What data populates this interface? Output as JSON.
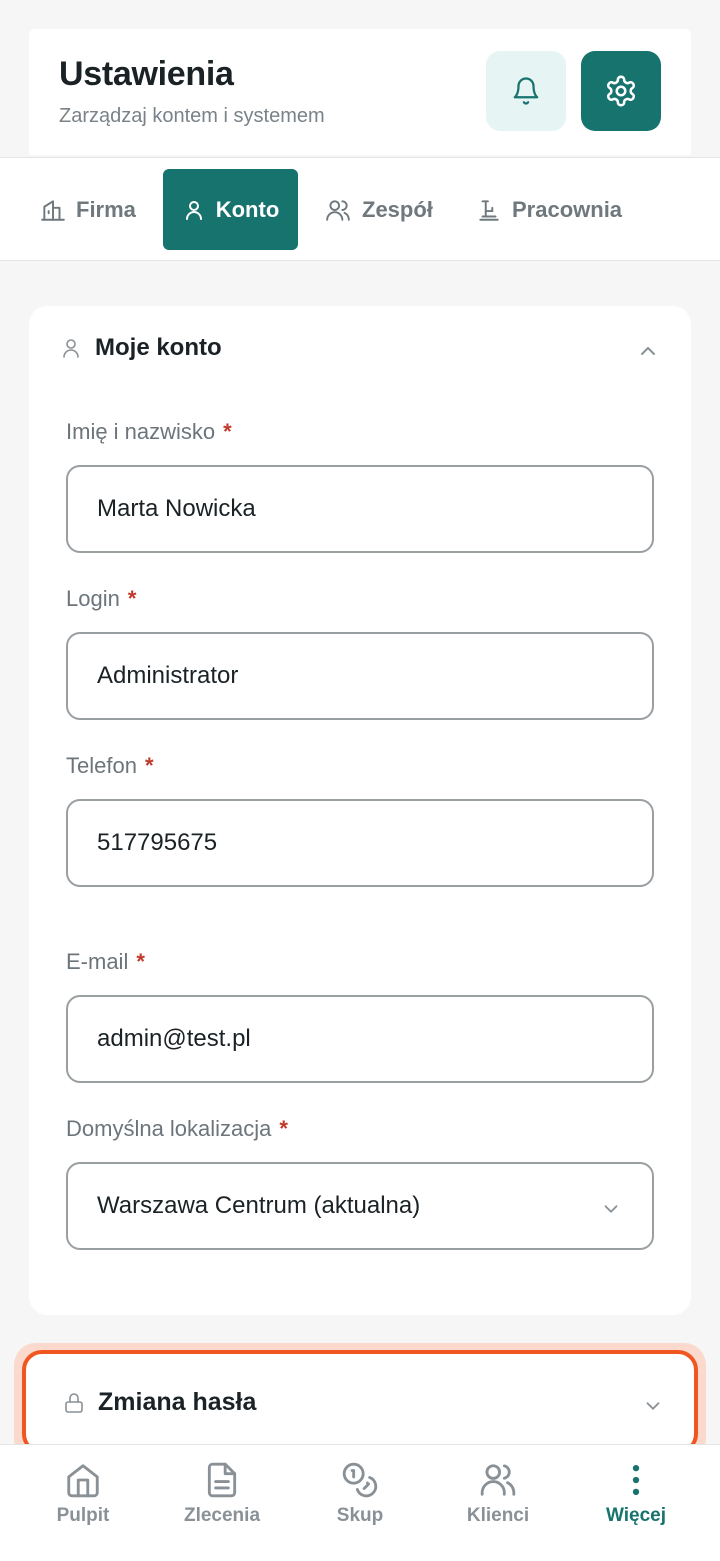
{
  "header": {
    "title": "Ustawienia",
    "subtitle": "Zarządzaj kontem i systemem",
    "bell_icon": "bell-icon",
    "settings_icon": "gear-icon"
  },
  "tabs": [
    {
      "label": "Firma",
      "icon": "building-icon",
      "active": false
    },
    {
      "label": "Konto",
      "icon": "user-icon",
      "active": true
    },
    {
      "label": "Zespół",
      "icon": "users-icon",
      "active": false
    },
    {
      "label": "Pracownia",
      "icon": "workbench-icon",
      "active": false
    }
  ],
  "account": {
    "title": "Moje konto",
    "fields": {
      "name": {
        "label": "Imię i nazwisko",
        "required": "*",
        "value": "Marta Nowicka"
      },
      "login": {
        "label": "Login",
        "required": "*",
        "value": "Administrator"
      },
      "phone": {
        "label": "Telefon",
        "required": "*",
        "value": "517795675"
      },
      "email": {
        "label": "E-mail",
        "required": "*",
        "value": "admin@test.pl"
      },
      "location": {
        "label": "Domyślna lokalizacja",
        "required": "*",
        "value": "Warszawa Centrum (aktualna)"
      }
    }
  },
  "password": {
    "title": "Zmiana hasła"
  },
  "bottom_nav": [
    {
      "label": "Pulpit",
      "icon": "home-icon",
      "active": false
    },
    {
      "label": "Zlecenia",
      "icon": "document-icon",
      "active": false
    },
    {
      "label": "Skup",
      "icon": "coins-icon",
      "active": false
    },
    {
      "label": "Klienci",
      "icon": "users-icon",
      "active": false
    },
    {
      "label": "Więcej",
      "icon": "more-vertical-icon",
      "active": true
    }
  ],
  "colors": {
    "accent": "#17736d",
    "accent_light": "#e6f5f4",
    "highlight": "#f0561f",
    "required": "#c0392b"
  }
}
